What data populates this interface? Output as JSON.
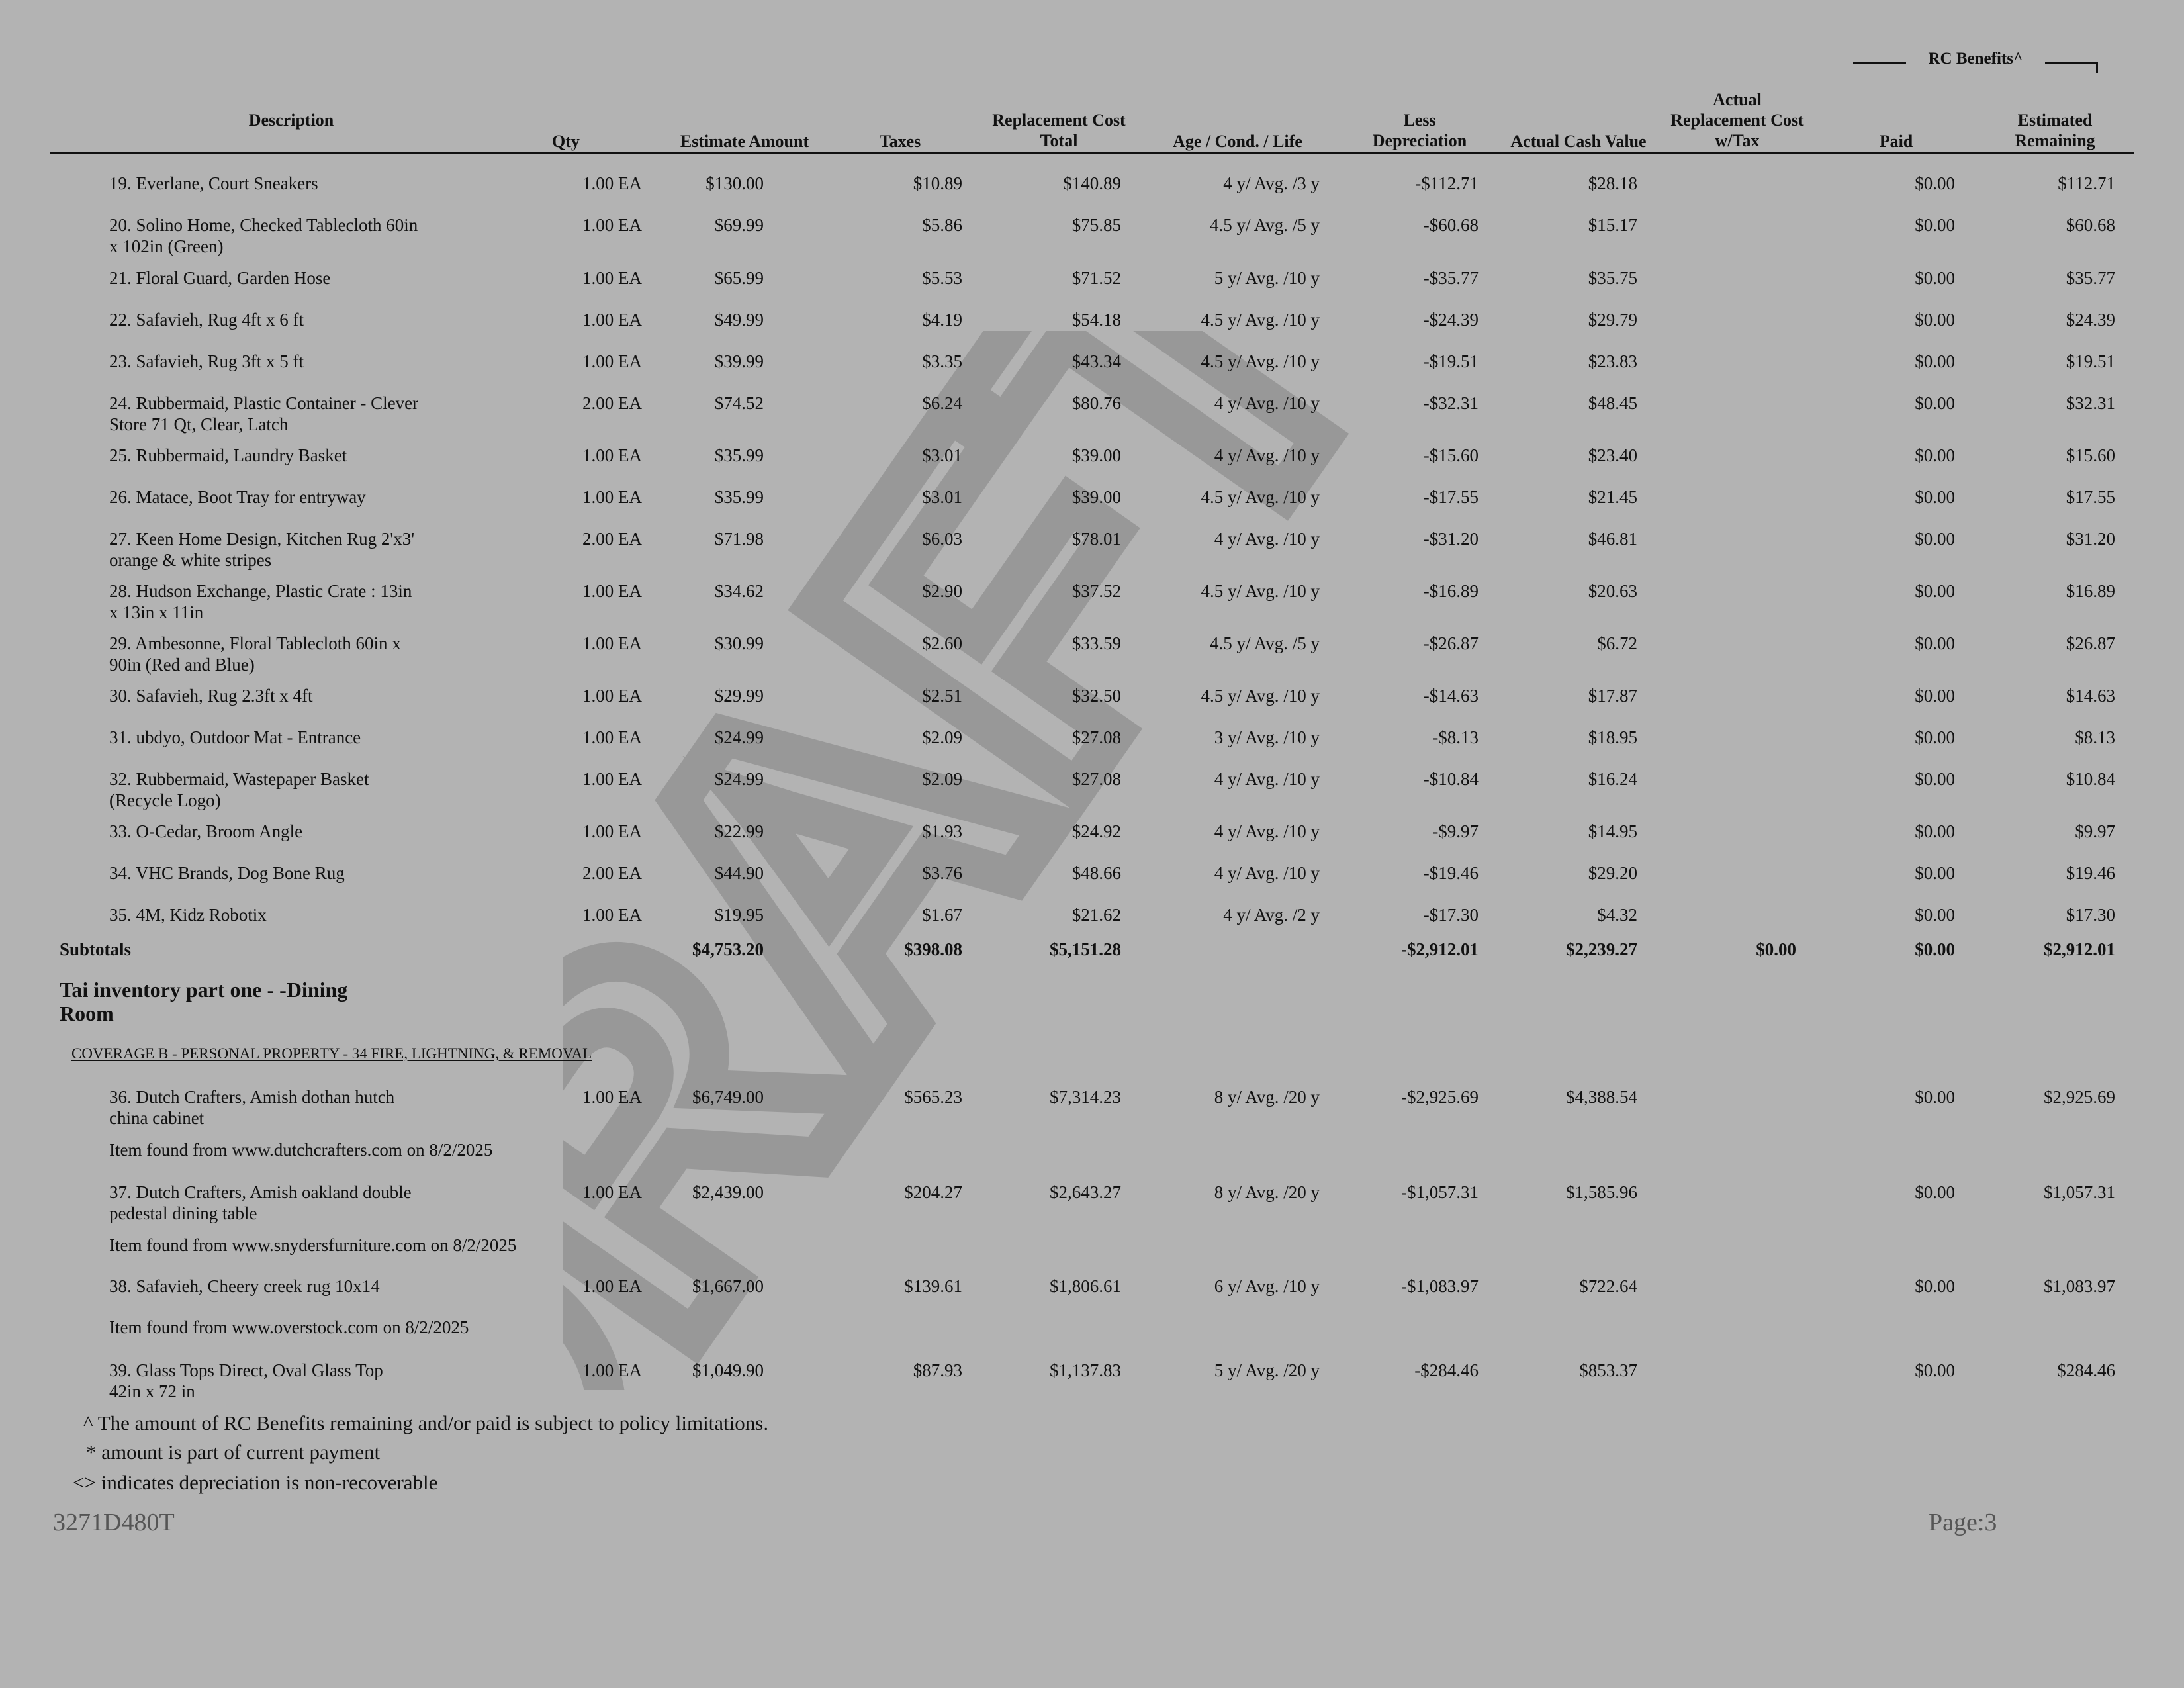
{
  "rc_benefits_label": "RC Benefits^",
  "headers": {
    "description": "Description",
    "qty": "Qty",
    "estimate_amount": "Estimate Amount",
    "taxes": "Taxes",
    "replacement_cost_total": "Replacement Cost\nTotal",
    "age_cond_life": "Age / Cond. / Life",
    "less_depreciation": "Less\nDepreciation",
    "actual_cash_value": "Actual Cash Value",
    "actual_replacement_cost": "Actual\nReplacement Cost\nw/Tax",
    "paid": "Paid",
    "estimated_remaining": "Estimated\nRemaining"
  },
  "rows": [
    {
      "desc": "19. Everlane, Court Sneakers",
      "qty": "1.00 EA",
      "est": "$130.00",
      "tax": "$10.89",
      "rc": "$140.89",
      "age": "4 y/ Avg. /3 y",
      "dep": "-$112.71",
      "acv": "$28.18",
      "paid": "$0.00",
      "rem": "$112.71"
    },
    {
      "desc": "20. Solino Home, Checked Tablecloth 60in\nx 102in (Green)",
      "qty": "1.00 EA",
      "est": "$69.99",
      "tax": "$5.86",
      "rc": "$75.85",
      "age": "4.5 y/ Avg. /5 y",
      "dep": "-$60.68",
      "acv": "$15.17",
      "paid": "$0.00",
      "rem": "$60.68"
    },
    {
      "desc": "21. Floral Guard, Garden Hose",
      "qty": "1.00 EA",
      "est": "$65.99",
      "tax": "$5.53",
      "rc": "$71.52",
      "age": "5 y/ Avg. /10 y",
      "dep": "-$35.77",
      "acv": "$35.75",
      "paid": "$0.00",
      "rem": "$35.77"
    },
    {
      "desc": "22. Safavieh, Rug 4ft x 6 ft",
      "qty": "1.00 EA",
      "est": "$49.99",
      "tax": "$4.19",
      "rc": "$54.18",
      "age": "4.5 y/ Avg. /10 y",
      "dep": "-$24.39",
      "acv": "$29.79",
      "paid": "$0.00",
      "rem": "$24.39"
    },
    {
      "desc": "23. Safavieh, Rug 3ft x 5 ft",
      "qty": "1.00 EA",
      "est": "$39.99",
      "tax": "$3.35",
      "rc": "$43.34",
      "age": "4.5 y/ Avg. /10 y",
      "dep": "-$19.51",
      "acv": "$23.83",
      "paid": "$0.00",
      "rem": "$19.51"
    },
    {
      "desc": "24. Rubbermaid, Plastic Container - Clever\nStore 71 Qt, Clear, Latch",
      "qty": "2.00 EA",
      "est": "$74.52",
      "tax": "$6.24",
      "rc": "$80.76",
      "age": "4 y/ Avg. /10 y",
      "dep": "-$32.31",
      "acv": "$48.45",
      "paid": "$0.00",
      "rem": "$32.31"
    },
    {
      "desc": "25. Rubbermaid, Laundry Basket",
      "qty": "1.00 EA",
      "est": "$35.99",
      "tax": "$3.01",
      "rc": "$39.00",
      "age": "4 y/ Avg. /10 y",
      "dep": "-$15.60",
      "acv": "$23.40",
      "paid": "$0.00",
      "rem": "$15.60"
    },
    {
      "desc": "26. Matace, Boot Tray for entryway",
      "qty": "1.00 EA",
      "est": "$35.99",
      "tax": "$3.01",
      "rc": "$39.00",
      "age": "4.5 y/ Avg. /10 y",
      "dep": "-$17.55",
      "acv": "$21.45",
      "paid": "$0.00",
      "rem": "$17.55"
    },
    {
      "desc": "27. Keen Home Design, Kitchen Rug 2'x3'\norange & white stripes",
      "qty": "2.00 EA",
      "est": "$71.98",
      "tax": "$6.03",
      "rc": "$78.01",
      "age": "4 y/ Avg. /10 y",
      "dep": "-$31.20",
      "acv": "$46.81",
      "paid": "$0.00",
      "rem": "$31.20"
    },
    {
      "desc": "28. Hudson Exchange, Plastic Crate : 13in\nx 13in x 11in",
      "qty": "1.00 EA",
      "est": "$34.62",
      "tax": "$2.90",
      "rc": "$37.52",
      "age": "4.5 y/ Avg. /10 y",
      "dep": "-$16.89",
      "acv": "$20.63",
      "paid": "$0.00",
      "rem": "$16.89"
    },
    {
      "desc": "29. Ambesonne, Floral Tablecloth 60in x\n90in (Red and Blue)",
      "qty": "1.00 EA",
      "est": "$30.99",
      "tax": "$2.60",
      "rc": "$33.59",
      "age": "4.5 y/ Avg. /5 y",
      "dep": "-$26.87",
      "acv": "$6.72",
      "paid": "$0.00",
      "rem": "$26.87"
    },
    {
      "desc": "30. Safavieh, Rug 2.3ft x 4ft",
      "qty": "1.00 EA",
      "est": "$29.99",
      "tax": "$2.51",
      "rc": "$32.50",
      "age": "4.5 y/ Avg. /10 y",
      "dep": "-$14.63",
      "acv": "$17.87",
      "paid": "$0.00",
      "rem": "$14.63"
    },
    {
      "desc": "31. ubdyo, Outdoor Mat - Entrance",
      "qty": "1.00 EA",
      "est": "$24.99",
      "tax": "$2.09",
      "rc": "$27.08",
      "age": "3 y/ Avg. /10 y",
      "dep": "-$8.13",
      "acv": "$18.95",
      "paid": "$0.00",
      "rem": "$8.13"
    },
    {
      "desc": "32. Rubbermaid, Wastepaper Basket\n(Recycle Logo)",
      "qty": "1.00 EA",
      "est": "$24.99",
      "tax": "$2.09",
      "rc": "$27.08",
      "age": "4 y/ Avg. /10 y",
      "dep": "-$10.84",
      "acv": "$16.24",
      "paid": "$0.00",
      "rem": "$10.84"
    },
    {
      "desc": "33.  O-Cedar, Broom Angle",
      "qty": "1.00 EA",
      "est": "$22.99",
      "tax": "$1.93",
      "rc": "$24.92",
      "age": "4 y/ Avg. /10 y",
      "dep": "-$9.97",
      "acv": "$14.95",
      "paid": "$0.00",
      "rem": "$9.97"
    },
    {
      "desc": "34. VHC  Brands, Dog Bone Rug",
      "qty": "2.00 EA",
      "est": "$44.90",
      "tax": "$3.76",
      "rc": "$48.66",
      "age": "4 y/ Avg. /10 y",
      "dep": "-$19.46",
      "acv": "$29.20",
      "paid": "$0.00",
      "rem": "$19.46"
    },
    {
      "desc": "35. 4M, Kidz Robotix",
      "qty": "1.00 EA",
      "est": "$19.95",
      "tax": "$1.67",
      "rc": "$21.62",
      "age": "4 y/ Avg. /2 y",
      "dep": "-$17.30",
      "acv": "$4.32",
      "paid": "$0.00",
      "rem": "$17.30"
    }
  ],
  "subtotals": {
    "label": "Subtotals",
    "est": "$4,753.20",
    "tax": "$398.08",
    "rc": "$5,151.28",
    "dep": "-$2,912.01",
    "acv": "$2,239.27",
    "arc": "$0.00",
    "paid": "$0.00",
    "rem": "$2,912.01"
  },
  "section_title": "Tai inventory part one  - -Dining\nRoom",
  "coverage": "COVERAGE B - PERSONAL PROPERTY - 34 FIRE, LIGHTNING, & REMOVAL",
  "rows2": [
    {
      "desc": "36. Dutch Crafters, Amish dothan hutch\nchina cabinet",
      "qty": "1.00 EA",
      "est": "$6,749.00",
      "tax": "$565.23",
      "rc": "$7,314.23",
      "age": "8 y/ Avg. /20 y",
      "dep": "-$2,925.69",
      "acv": "$4,388.54",
      "paid": "$0.00",
      "rem": "$2,925.69",
      "note": "Item found from www.dutchcrafters.com on 8/2/2025"
    },
    {
      "desc": "37. Dutch Crafters, Amish oakland double\npedestal dining table",
      "qty": "1.00 EA",
      "est": "$2,439.00",
      "tax": "$204.27",
      "rc": "$2,643.27",
      "age": "8 y/ Avg. /20 y",
      "dep": "-$1,057.31",
      "acv": "$1,585.96",
      "paid": "$0.00",
      "rem": "$1,057.31",
      "note": "Item found from www.snydersfurniture.com on 8/2/2025"
    },
    {
      "desc": "38. Safavieh, Cheery creek rug 10x14",
      "qty": "1.00 EA",
      "est": "$1,667.00",
      "tax": "$139.61",
      "rc": "$1,806.61",
      "age": "6 y/ Avg. /10 y",
      "dep": "-$1,083.97",
      "acv": "$722.64",
      "paid": "$0.00",
      "rem": "$1,083.97",
      "note": "Item found from www.overstock.com on 8/2/2025"
    },
    {
      "desc": "39. Glass Tops Direct, Oval Glass Top\n42in x 72 in",
      "qty": "1.00 EA",
      "est": "$1,049.90",
      "tax": "$87.93",
      "rc": "$1,137.83",
      "age": "5 y/ Avg. /20 y",
      "dep": "-$284.46",
      "acv": "$853.37",
      "paid": "$0.00",
      "rem": "$284.46",
      "note": ""
    }
  ],
  "footnotes": [
    "^ The amount of RC Benefits remaining and/or paid is subject to policy limitations.",
    "* amount is part of current payment",
    "<> indicates depreciation is non-recoverable"
  ],
  "footer": {
    "code": "3271D480T",
    "page": "Page:3"
  },
  "watermark": "DRAFT"
}
